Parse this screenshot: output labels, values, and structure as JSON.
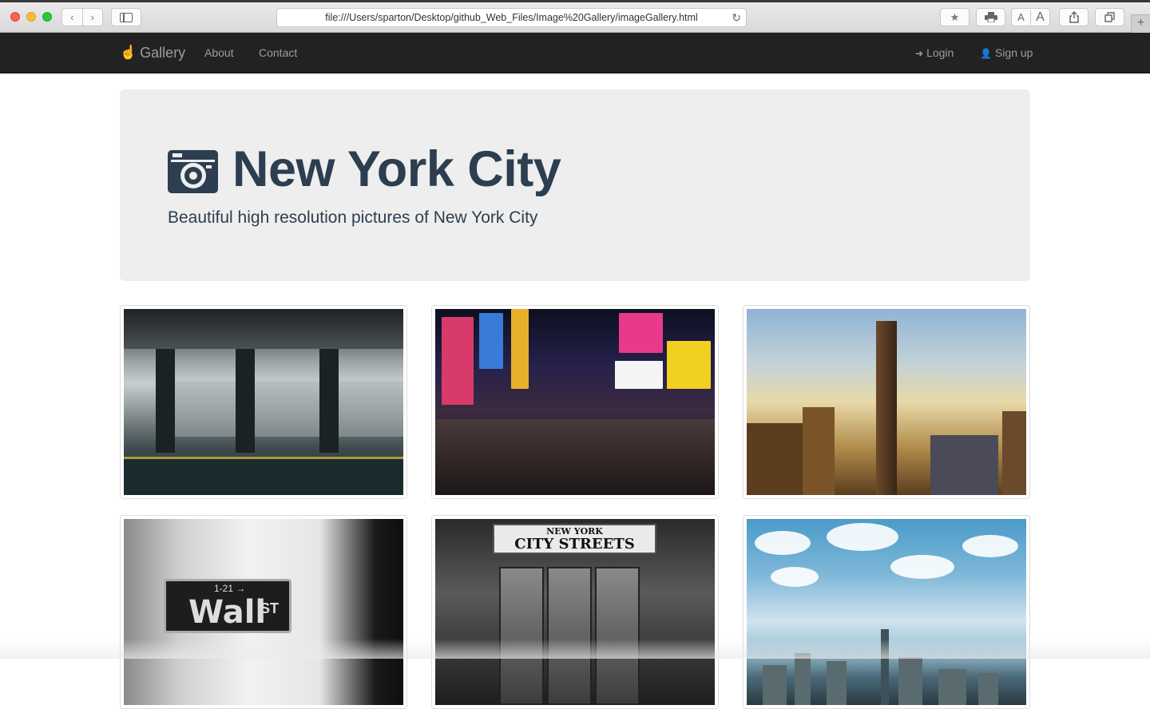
{
  "browser": {
    "url": "file:///Users/sparton/Desktop/github_Web_Files/Image%20Gallery/imageGallery.html",
    "font_small": "A",
    "font_large": "A",
    "new_tab": "+"
  },
  "navbar": {
    "brand": "Gallery",
    "links": [
      "About",
      "Contact"
    ],
    "right": {
      "login": "Login",
      "signup": "Sign up"
    }
  },
  "jumbotron": {
    "title": "New York City",
    "subtitle": "Beautiful high resolution pictures of New York City",
    "icon": "camera-icon"
  },
  "gallery": {
    "photos": [
      {
        "name": "subway-station"
      },
      {
        "name": "times-square-night"
      },
      {
        "name": "empire-state-building"
      },
      {
        "name": "wall-street-sign",
        "sign_text": "Wall",
        "sign_suffix": "ST",
        "sign_number": "1-21 →"
      },
      {
        "name": "city-streets-storefront",
        "board_line1": "NEW YORK",
        "board_line2": "CITY STREETS"
      },
      {
        "name": "manhattan-skyline"
      }
    ]
  },
  "colors": {
    "navbar_bg": "#222222",
    "navbar_text": "#9d9d9d",
    "jumbotron_bg": "#eeeeee",
    "title_color": "#2c3e50"
  }
}
